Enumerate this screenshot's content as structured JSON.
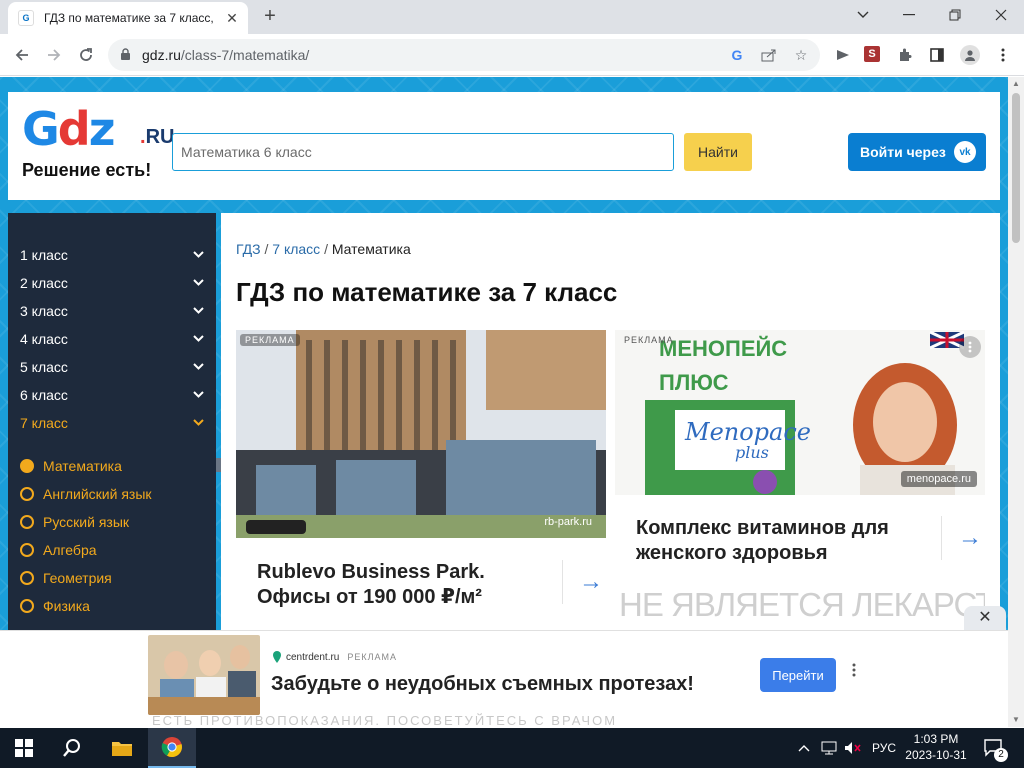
{
  "browser": {
    "tab_title": "ГДЗ по математике за 7 класс, ",
    "url_host": "gdz.ru",
    "url_path": "/class-7/matematika/"
  },
  "header": {
    "logo_ru": "RU",
    "slogan": "Решение есть!",
    "search_placeholder": "Математика 6 класс",
    "find_label": "Найти",
    "vk_label": "Войти через",
    "vk_icon": "vk"
  },
  "sidebar": {
    "classes": [
      {
        "label": "1 класс"
      },
      {
        "label": "2 класс"
      },
      {
        "label": "3 класс"
      },
      {
        "label": "4 класс"
      },
      {
        "label": "5 класс"
      },
      {
        "label": "6 класс"
      },
      {
        "label": "7 класс"
      }
    ],
    "subjects": [
      {
        "label": "Математика"
      },
      {
        "label": "Английский язык"
      },
      {
        "label": "Русский язык"
      },
      {
        "label": "Алгебра"
      },
      {
        "label": "Геометрия"
      },
      {
        "label": "Физика"
      }
    ]
  },
  "main": {
    "breadcrumb": {
      "root": "ГДЗ",
      "sep": " / ",
      "level": "7 класс",
      "current": "Математика"
    },
    "title": "ГДЗ по математике за 7 класс",
    "ads": [
      {
        "label": "РЕКЛАМА",
        "domain": "rb-park.ru",
        "headline": "Rublevo Business Park. Офисы от 190 000 ₽/м²"
      },
      {
        "label": "РЕКЛАМА",
        "brand": "МЕНОПЕЙС ПЛЮС",
        "domain": "menopace.ru",
        "headline": "Комплекс витаминов для женского здоровья",
        "disclaimer": "НЕ ЯВЛЯЕТСЯ ЛЕКАРСТВОМ"
      }
    ]
  },
  "bottom_ad": {
    "domain": "centrdent.ru",
    "label": "РЕКЛАМА",
    "headline": "Забудьте о неудобных съемных протезах!",
    "button": "Перейти",
    "disclaimer": "ЕСТЬ ПРОТИВОПОКАЗАНИЯ. ПОСОВЕТУЙТЕСЬ С ВРАЧОМ"
  },
  "taskbar": {
    "lang": "РУС",
    "time": "1:03 PM",
    "date": "2023-10-31",
    "notifications": "2"
  },
  "colors": {
    "brand_blue": "#1a9ed9",
    "sidebar_bg": "#1e2a3c",
    "accent_orange": "#f2a91d",
    "find_yellow": "#f6d04d",
    "vk_blue": "#0a7ed1"
  }
}
